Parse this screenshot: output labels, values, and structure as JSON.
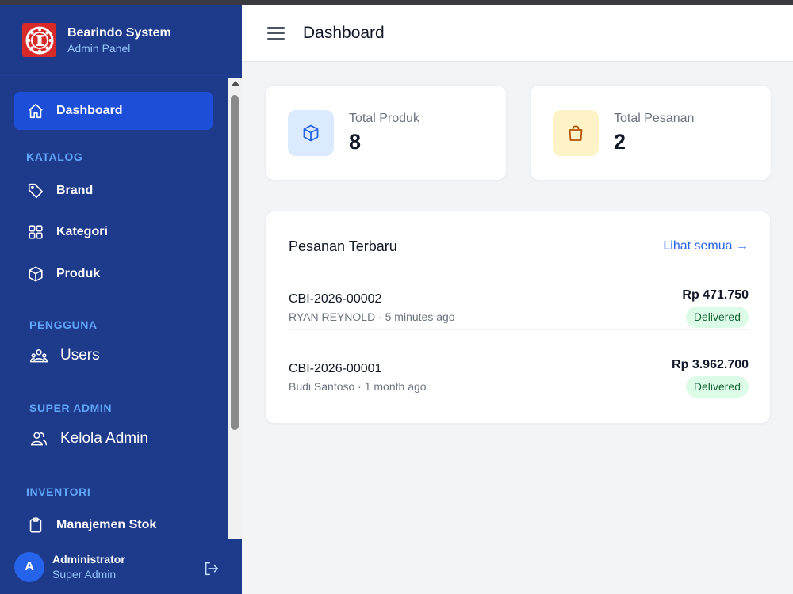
{
  "app": {
    "brand_title": "Bearindo System",
    "brand_subtitle": "Admin Panel"
  },
  "sidebar": {
    "dashboard_label": "Dashboard",
    "sections": {
      "katalog": "KATALOG",
      "pengguna": "PENGGUNA",
      "super_admin": "SUPER ADMIN",
      "inventori": "INVENTORI"
    },
    "items": {
      "brand": "Brand",
      "kategori": "Kategori",
      "produk": "Produk",
      "users": "Users",
      "kelola_admin": "Kelola Admin",
      "manajemen_stok": "Manajemen Stok"
    },
    "icons": {
      "dashboard": "home-icon",
      "brand": "tag-icon",
      "kategori": "grid-icon",
      "produk": "cube-icon",
      "users": "users-icon",
      "kelola_admin": "user-group-icon",
      "manajemen_stok": "clipboard-icon"
    }
  },
  "user": {
    "avatar_initial": "A",
    "name": "Administrator",
    "role": "Super Admin"
  },
  "header": {
    "title": "Dashboard"
  },
  "stats": [
    {
      "label": "Total Produk",
      "value": "8",
      "icon": "cube-icon",
      "icon_bg": "#dbeafe",
      "icon_color": "#2563eb"
    },
    {
      "label": "Total Pesanan",
      "value": "2",
      "icon": "shopping-bag-icon",
      "icon_bg": "#fef3c7",
      "icon_color": "#b45309"
    }
  ],
  "recent_orders": {
    "title": "Pesanan Terbaru",
    "see_all": "Lihat semua →",
    "rows": [
      {
        "id": "CBI-2026-00002",
        "meta": "RYAN REYNOLD · 5 minutes ago",
        "amount": "Rp 471.750",
        "status": "Delivered"
      },
      {
        "id": "CBI-2026-00001",
        "meta": "Budi Santoso · 1 month ago",
        "amount": "Rp 3.962.700",
        "status": "Delivered"
      }
    ]
  },
  "colors": {
    "sidebar_bg": "#1e3a8a",
    "active_bg": "#1d4ed8",
    "accent": "#2563eb",
    "success_bg": "#dcfce7",
    "success_text": "#166534"
  }
}
